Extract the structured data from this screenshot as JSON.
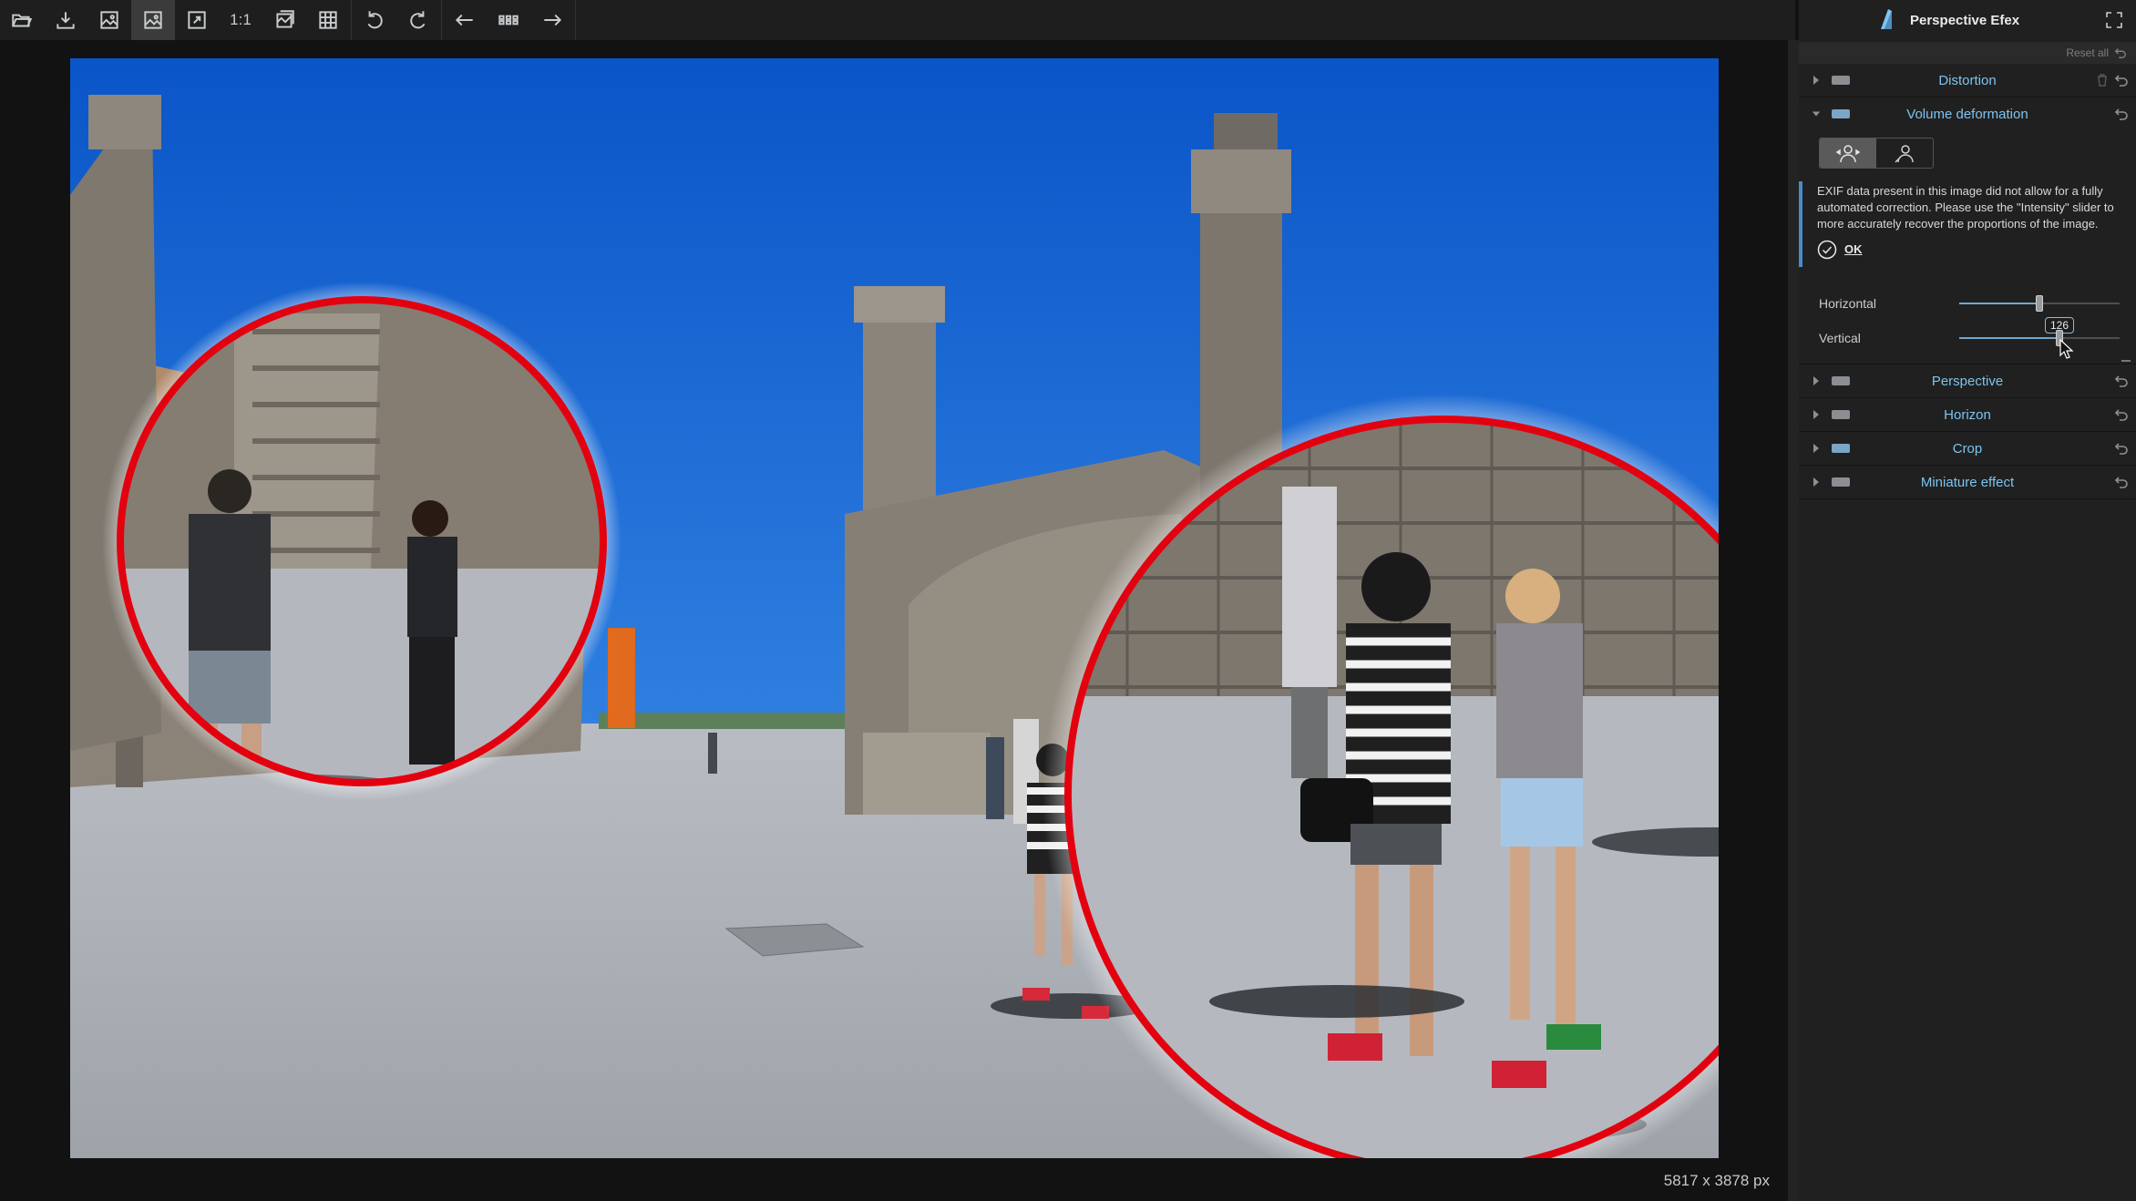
{
  "toolbar": {
    "tools": [
      {
        "name": "open-icon"
      },
      {
        "name": "save-icon"
      },
      {
        "name": "compare-icon"
      },
      {
        "name": "image-view-icon",
        "active": true
      },
      {
        "name": "fit-icon"
      },
      {
        "name": "one-to-one",
        "label": "1:1"
      },
      {
        "name": "clipping-icon"
      },
      {
        "name": "grid-icon"
      },
      {
        "name": "rotate-left-icon"
      },
      {
        "name": "rotate-right-icon"
      },
      {
        "name": "arrow-left-icon"
      },
      {
        "name": "filmstrip-icon"
      },
      {
        "name": "arrow-right-icon"
      }
    ]
  },
  "image": {
    "dimensions": "5817 x 3878 px"
  },
  "panel": {
    "title": "Perspective Efex",
    "reset_all": "Reset all",
    "sections": {
      "distortion": "Distortion",
      "volume_deformation": "Volume deformation",
      "perspective": "Perspective",
      "horizon": "Horizon",
      "crop": "Crop",
      "miniature": "Miniature effect"
    },
    "notice": "EXIF data present in this image did not allow for a fully automated correction. Please use the \"Intensity\" slider to more accurately recover the proportions of the image.",
    "ok": "OK",
    "sliders": {
      "horizontal": {
        "label": "Horizontal"
      },
      "vertical": {
        "label": "Vertical",
        "value": "126"
      }
    }
  },
  "colors": {
    "accent": "#7ec3f0",
    "highlight_ring": "#e3000f"
  }
}
